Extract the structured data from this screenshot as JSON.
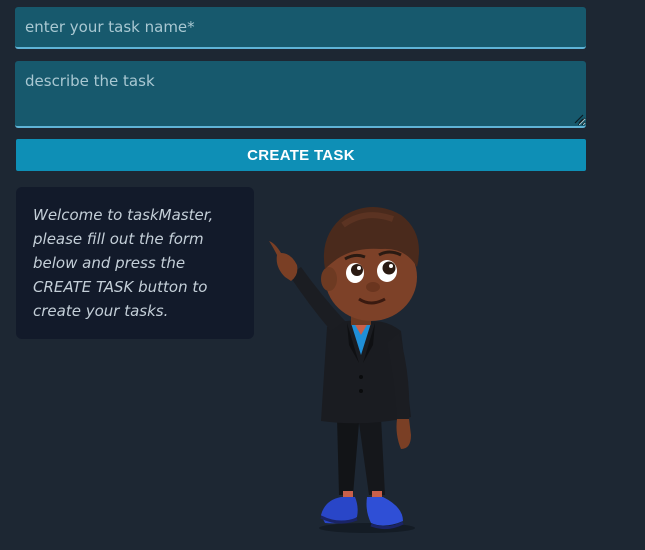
{
  "form": {
    "task_name_placeholder": "enter your task name*",
    "task_description_placeholder": "describe the task",
    "create_button_label": "CREATE TASK"
  },
  "welcome": {
    "message": "Welcome to taskMaster, please fill out the form below and press the CREATE TASK button to create your tasks."
  },
  "colors": {
    "background": "#1d2733",
    "input_background": "#17596d",
    "input_border": "#5fb3d6",
    "button_background": "#0e8fb6",
    "card_background": "#121a2a"
  },
  "icons": {
    "mascot": "pointing-boy-illustration"
  }
}
